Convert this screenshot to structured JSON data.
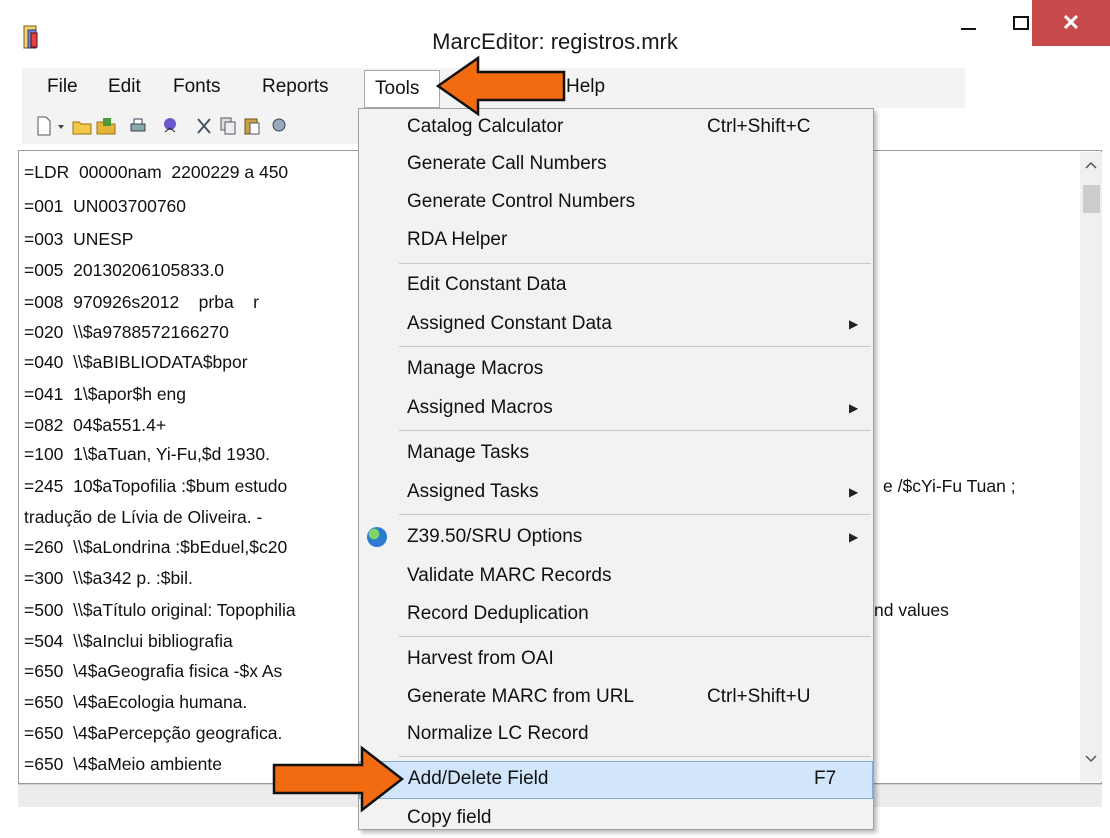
{
  "window": {
    "title": "MarcEditor: registros.mrk",
    "close_label": "✕"
  },
  "menubar": {
    "items": [
      "File",
      "Edit",
      "Fonts",
      "Reports",
      "Tools",
      "Help"
    ]
  },
  "editor_lines": [
    "=LDR  00000nam  2200229 a 450",
    "=001  UN003700760",
    "=003  UNESP",
    "=005  20130206105833.0",
    "=008  970926s2012    prba    r",
    "=020  \\\\$a9788572166270",
    "=040  \\\\$aBIBLIODATA$bpor",
    "=041  1\\$apor$h eng",
    "=082  04$a551.4+",
    "=100  1\\$aTuan, Yi-Fu,$d 1930.",
    "=245  10$aTopofilia :$bum estudo",
    "tradução de Lívia de Oliveira. -",
    "=260  \\\\$aLondrina :$bEduel,$c20",
    "=300  \\\\$a342 p. :$bil.",
    "=500  \\\\$aTítulo original: Topophilia",
    "=504  \\\\$aInclui bibliografia",
    "=650  \\4$aGeografia fisica -$x As",
    "=650  \\4$aEcologia humana.",
    "=650  \\4$aPercepção geografica.",
    "=650  \\4$aMeio ambiente"
  ],
  "editor_overflow": {
    "line245_tail": "e /$cYi-Fu Tuan ;",
    "line500_tail": "nd values"
  },
  "tools_menu": [
    {
      "label": "Catalog Calculator",
      "shortcut": "Ctrl+Shift+C",
      "submenu": false
    },
    {
      "label": "Generate Call Numbers",
      "shortcut": "",
      "submenu": false
    },
    {
      "label": "Generate Control Numbers",
      "shortcut": "",
      "submenu": false
    },
    {
      "label": "RDA Helper",
      "shortcut": "",
      "submenu": false
    },
    {
      "label": "Edit Constant Data",
      "shortcut": "",
      "submenu": false
    },
    {
      "label": "Assigned Constant Data",
      "shortcut": "",
      "submenu": true
    },
    {
      "label": "Manage Macros",
      "shortcut": "",
      "submenu": false
    },
    {
      "label": "Assigned Macros",
      "shortcut": "",
      "submenu": true
    },
    {
      "label": "Manage Tasks",
      "shortcut": "",
      "submenu": false
    },
    {
      "label": "Assigned Tasks",
      "shortcut": "",
      "submenu": true
    },
    {
      "label": "Z39.50/SRU Options",
      "shortcut": "",
      "submenu": true
    },
    {
      "label": "Validate MARC Records",
      "shortcut": "",
      "submenu": false
    },
    {
      "label": "Record Deduplication",
      "shortcut": "",
      "submenu": false
    },
    {
      "label": "Harvest from OAI",
      "shortcut": "",
      "submenu": false
    },
    {
      "label": "Generate MARC from URL",
      "shortcut": "Ctrl+Shift+U",
      "submenu": false
    },
    {
      "label": "Normalize LC Record",
      "shortcut": "",
      "submenu": false
    },
    {
      "label": "Add/Delete Field",
      "shortcut": "F7",
      "submenu": false,
      "highlighted": true
    },
    {
      "label": "Copy field",
      "shortcut": "",
      "submenu": false
    }
  ],
  "colors": {
    "arrow": "#f26b10",
    "highlight": "#d1e6fa",
    "close_button": "#c94a4a"
  }
}
